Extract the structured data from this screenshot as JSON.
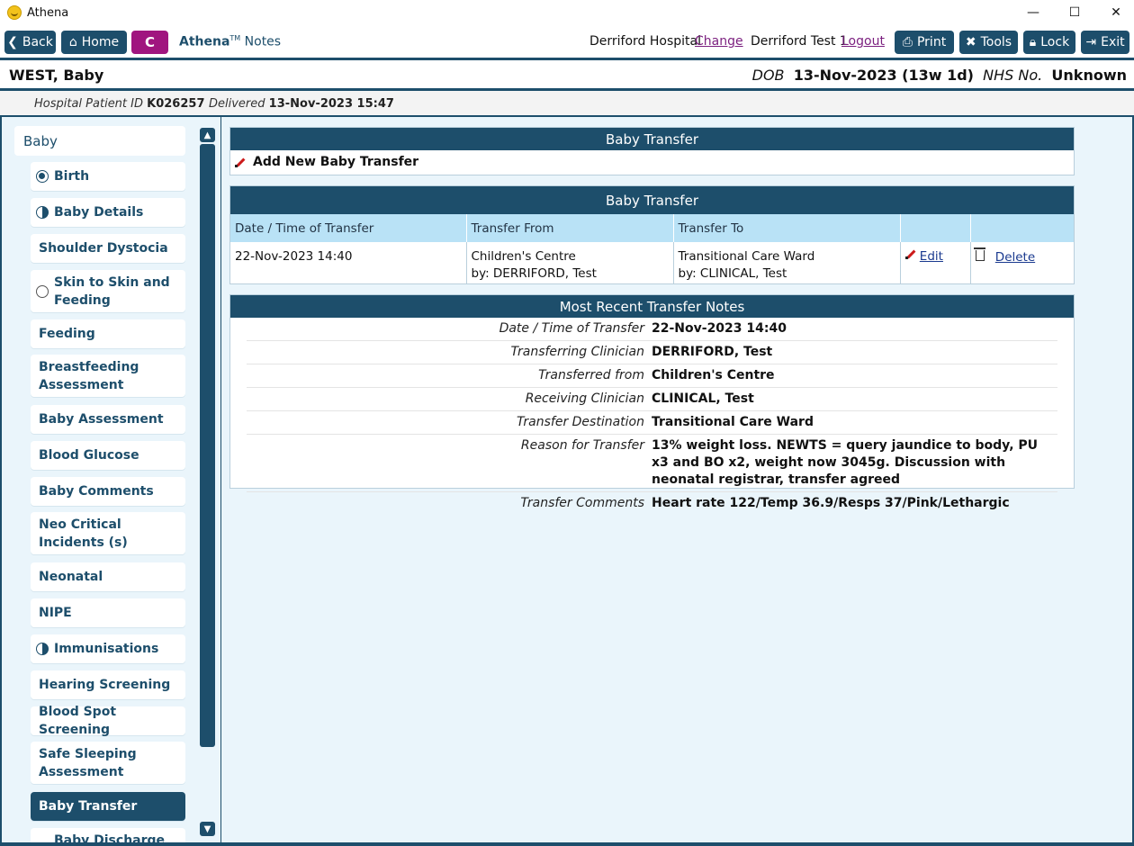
{
  "window": {
    "title": "Athena",
    "controls": {
      "minimize": "—",
      "maximize": "☐",
      "close": "✕"
    }
  },
  "toolbar": {
    "back_label": "Back",
    "home_label": "Home",
    "c_label": "C",
    "app_name": "Athena",
    "app_tm": "TM",
    "app_section": "Notes",
    "hospital": "Derriford Hospital",
    "change_label": "Change",
    "user": "Derriford Test 1",
    "logout_label": "Logout",
    "print_label": "Print",
    "tools_label": "Tools",
    "lock_label": "Lock",
    "exit_label": "Exit"
  },
  "patient": {
    "name": "WEST, Baby",
    "dob_label": "DOB",
    "dob_value": "13-Nov-2023 (13w 1d)",
    "nhs_label": "NHS No.",
    "nhs_value": "Unknown",
    "hospital_id_label": "Hospital Patient ID",
    "hospital_id_value": "K026257",
    "delivered_label": "Delivered",
    "delivered_value": "13-Nov-2023 15:47"
  },
  "sidebar": {
    "group_label": "Baby",
    "items": [
      {
        "label": "Birth",
        "status": "full"
      },
      {
        "label": "Baby Details",
        "status": "half"
      },
      {
        "label": "Shoulder Dystocia",
        "status": ""
      },
      {
        "label": "Skin to Skin and Feeding",
        "status": "empty"
      },
      {
        "label": "Feeding",
        "status": ""
      },
      {
        "label": "Breastfeeding Assessment",
        "status": ""
      },
      {
        "label": "Baby Assessment",
        "status": ""
      },
      {
        "label": "Blood Glucose",
        "status": ""
      },
      {
        "label": "Baby Comments",
        "status": ""
      },
      {
        "label": "Neo Critical Incidents (s)",
        "status": ""
      },
      {
        "label": "Neonatal",
        "status": ""
      },
      {
        "label": "NIPE",
        "status": ""
      },
      {
        "label": "Immunisations",
        "status": "half"
      },
      {
        "label": "Hearing Screening",
        "status": ""
      },
      {
        "label": "Blood Spot Screening",
        "status": ""
      },
      {
        "label": "Safe Sleeping Assessment",
        "status": ""
      },
      {
        "label": "Baby Transfer",
        "status": ""
      },
      {
        "label": "Baby Discharge",
        "status": ""
      }
    ]
  },
  "add_panel": {
    "title": "Baby Transfer",
    "add_label": "Add New Baby Transfer"
  },
  "transfer_table": {
    "title": "Baby Transfer",
    "headers": [
      "Date / Time of Transfer",
      "Transfer From",
      "Transfer To",
      "",
      ""
    ],
    "row": {
      "datetime": "22-Nov-2023 14:40",
      "from": "Children's Centre",
      "from_by": "by: DERRIFORD, Test",
      "to": "Transitional Care Ward",
      "to_by": "by: CLINICAL, Test",
      "edit_label": "Edit",
      "delete_label": "Delete"
    }
  },
  "notes": {
    "title": "Most Recent Transfer Notes",
    "rows": [
      {
        "label": "Date / Time of Transfer",
        "value": "22-Nov-2023 14:40"
      },
      {
        "label": "Transferring Clinician",
        "value": "DERRIFORD, Test"
      },
      {
        "label": "Transferred from",
        "value": "Children's Centre"
      },
      {
        "label": "Receiving Clinician",
        "value": "CLINICAL, Test"
      },
      {
        "label": "Transfer Destination",
        "value": "Transitional Care Ward"
      },
      {
        "label": "Reason for Transfer",
        "value": "13% weight loss. NEWTS = query jaundice to body, PU x3 and BO x2, weight now 3045g. Discussion with neonatal registrar, transfer agreed"
      },
      {
        "label": "Transfer Comments",
        "value": "Heart rate 122/Temp 36.9/Resps 37/Pink/Lethargic"
      }
    ]
  }
}
